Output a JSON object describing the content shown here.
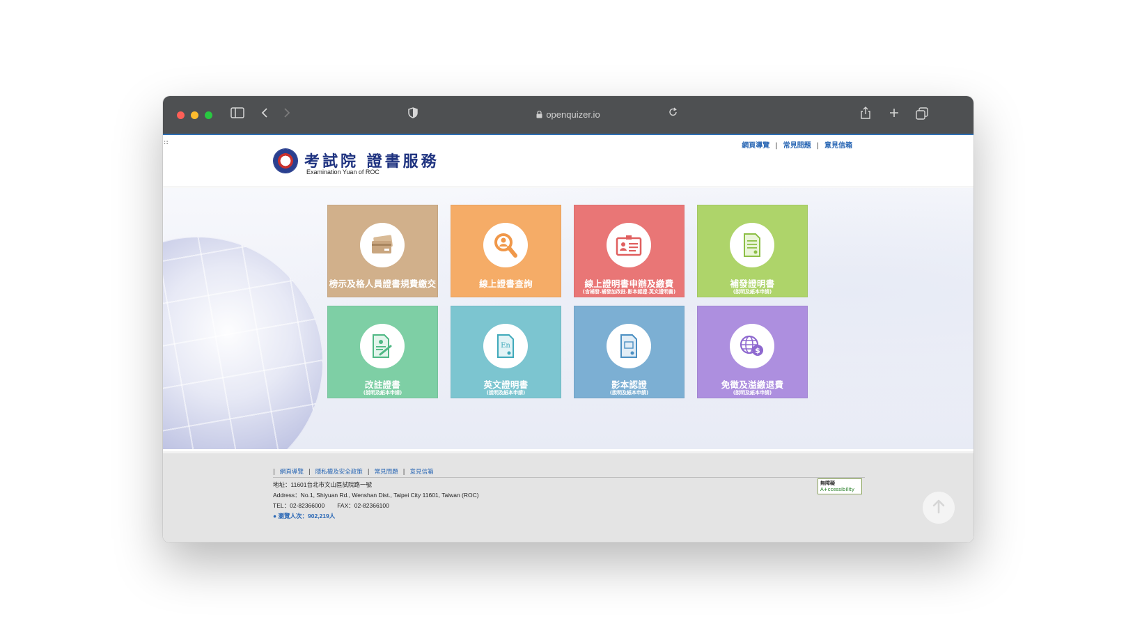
{
  "browser": {
    "url": "openquizer.io"
  },
  "header": {
    "logo_title": "考試院 證書服務",
    "logo_subtitle": "Examination Yuan of ROC",
    "links": [
      "網頁導覽",
      "常見問題",
      "意見信箱"
    ]
  },
  "tiles": [
    {
      "label": "榜示及格人員證書規費繳交",
      "sub": "",
      "icon": "credit-card-icon",
      "color": "#d1b08b"
    },
    {
      "label": "線上證書查詢",
      "sub": "",
      "icon": "magnifier-user-icon",
      "color": "#f5ac67"
    },
    {
      "label": "線上證明書申辦及繳費",
      "sub": "(含補發.補發加改註.影本認證.英文證明書)",
      "icon": "id-card-icon",
      "color": "#e97676"
    },
    {
      "label": "補發證明書",
      "sub": "(說明及紙本申請)",
      "icon": "document-icon",
      "color": "#aed46a"
    },
    {
      "label": "改註證書",
      "sub": "(說明及紙本申請)",
      "icon": "edit-certificate-icon",
      "color": "#7ecfa5"
    },
    {
      "label": "英文證明書",
      "sub": "(說明及紙本申請)",
      "icon": "english-document-icon",
      "color": "#7cc5d0"
    },
    {
      "label": "影本認證",
      "sub": "(說明及紙本申請)",
      "icon": "copy-document-icon",
      "color": "#7cafd3"
    },
    {
      "label": "免徵及溢繳退費",
      "sub": "(說明及紙本申請)",
      "icon": "globe-money-icon",
      "color": "#ad8fdf"
    }
  ],
  "footer": {
    "links": [
      "網頁導覽",
      "隱私權及安全政策",
      "常見問題",
      "意見信箱"
    ],
    "address_zh": "地址：11601台北市文山區試院路一號",
    "address_en": "Address：No.1, Shiyuan Rd., Wenshan Dist., Taipei City 11601, Taiwan (ROC)",
    "tel": "TEL：02-82366000",
    "fax": "FAX：02-82366100",
    "visits": "● 瀏覽人次：902,219人",
    "badge_line1": "無障礙",
    "badge_line2": "A+ccessibility"
  }
}
